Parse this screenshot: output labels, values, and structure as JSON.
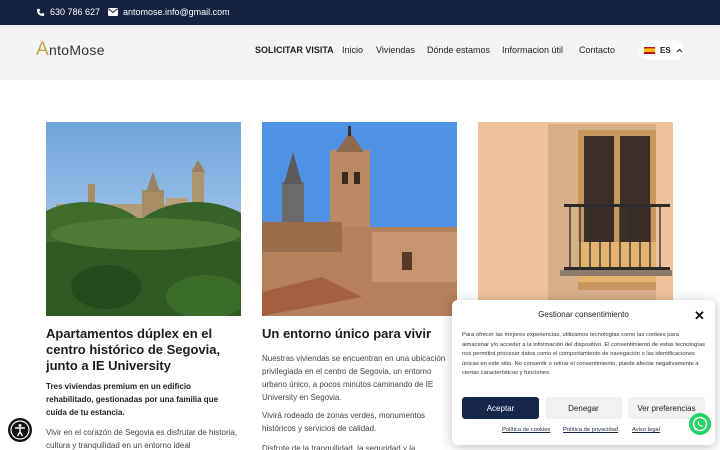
{
  "topbar": {
    "phone": "630 786 627",
    "email": "antomose.info@gmail.com"
  },
  "header": {
    "logo_initial": "A",
    "logo_rest": "ntoMose",
    "nav": [
      "SOLICITAR VISITA",
      "Inicio",
      "Viviendas",
      "Dónde estamos",
      "Informacion útil",
      "Contacto"
    ],
    "language": "ES"
  },
  "cards": [
    {
      "title": "Apartamentos dúplex en el centro histórico de Segovia, junto a IE University",
      "subtitle": "Tres viviendas premium en un edificio rehabilitado, gestionadas por una familia que cuida de tu estancia.",
      "body": "Vivir en el corazón de Segovia es disfrutar de historia, cultura y tranquilidad en un entorno ideal"
    },
    {
      "title": "Un entorno único para vivir",
      "body1": "Nuestras viviendas se encuentran en una ubicación privilegiada en el centro de Segovia, un entorno urbano único, a pocos minutos caminando de IE University en Segovia.",
      "body2": "Vivirá rodeado de zonas verdes, monumentos históricos y servicios de calidad.",
      "body3": "Disfrute de la tranquilidad, la seguridad y la"
    },
    {}
  ],
  "cookie": {
    "title": "Gestionar consentimiento",
    "text": "Para ofrecer las mejores experiencias, utilizamos tecnologías como las cookies para almacenar y/o acceder a la información del dispositivo. El consentimiento de estas tecnologías nos permitirá procesar datos como el comportamiento de navegación o las identificaciones únicas en este sitio. No consentir o retirar el consentimiento, puede afectar negativamente a ciertas características y funciones.",
    "accept": "Aceptar",
    "deny": "Denegar",
    "preferences": "Ver preferencias",
    "links": [
      "Política de cookies",
      "Política de privacidad",
      "Aviso legal"
    ]
  },
  "colors": {
    "topbar": "#152240",
    "accent_gold": "#c9a24c",
    "accept_button": "#17274b",
    "whatsapp": "#25d366"
  },
  "icons": [
    "phone-icon",
    "mail-icon",
    "chevron-up-icon",
    "close-icon",
    "accessibility-icon",
    "whatsapp-icon"
  ]
}
